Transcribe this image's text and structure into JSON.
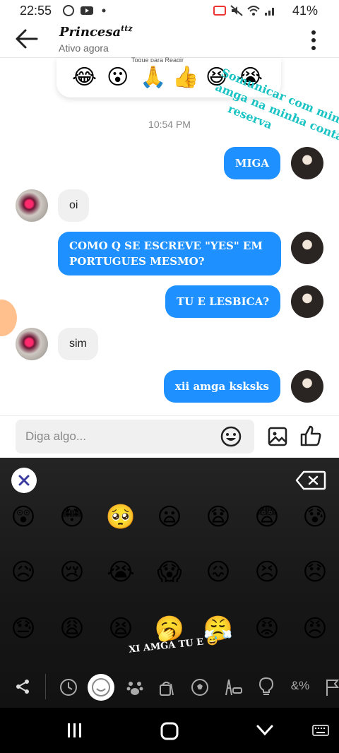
{
  "status_bar": {
    "time": "22:55",
    "battery": "41%"
  },
  "header": {
    "name": "Princesa",
    "name_sup": "ttz",
    "status": "Ativo agora"
  },
  "reactions": {
    "hint": "Toque para Reagir",
    "emojis": [
      "😂",
      "😮",
      "🙏",
      "👍",
      "😆",
      "😭"
    ]
  },
  "timestamp": "10:54 PM",
  "messages": [
    {
      "from": "me",
      "text": "MIGA"
    },
    {
      "from": "her",
      "text": "oi"
    },
    {
      "from": "me",
      "text": "COMO Q SE ESCREVE \"YES\" EM PORTUGUES MESMO?"
    },
    {
      "from": "me",
      "text": "TU E LESBICA?"
    },
    {
      "from": "her",
      "text": "sim"
    },
    {
      "from": "me",
      "text": "xii amga ksksks"
    }
  ],
  "overlay_text": "Somunicar com minha amga na minha conta reserva",
  "overlay_lines": [
    "Somunicar com minha",
    "amga na minha conta",
    "reserva"
  ],
  "input": {
    "placeholder": "Diga algo..."
  },
  "keyboard": {
    "rows": [
      [
        "😲",
        "😳",
        "🥺",
        "😦",
        "😧",
        "😨",
        "😰"
      ],
      [
        "😥",
        "😢",
        "😭",
        "😱",
        "😖",
        "😣",
        "😞"
      ],
      [
        "😓",
        "😩",
        "😫",
        "🥱",
        "😤",
        "😡",
        "😠"
      ]
    ],
    "overlay_caption": "XI AMGA TU E 😅",
    "tool_symbols": "&%",
    "tabs": [
      "share-icon",
      "recent-icon",
      "smiley-icon",
      "animals-icon",
      "food-icon",
      "sports-icon",
      "travel-icon",
      "objects-icon",
      "symbols-icon",
      "flags-icon"
    ]
  },
  "colors": {
    "bubble_me": "#1e90ff",
    "bubble_her": "#f0f0f0",
    "overlay": "#19c3c3"
  }
}
